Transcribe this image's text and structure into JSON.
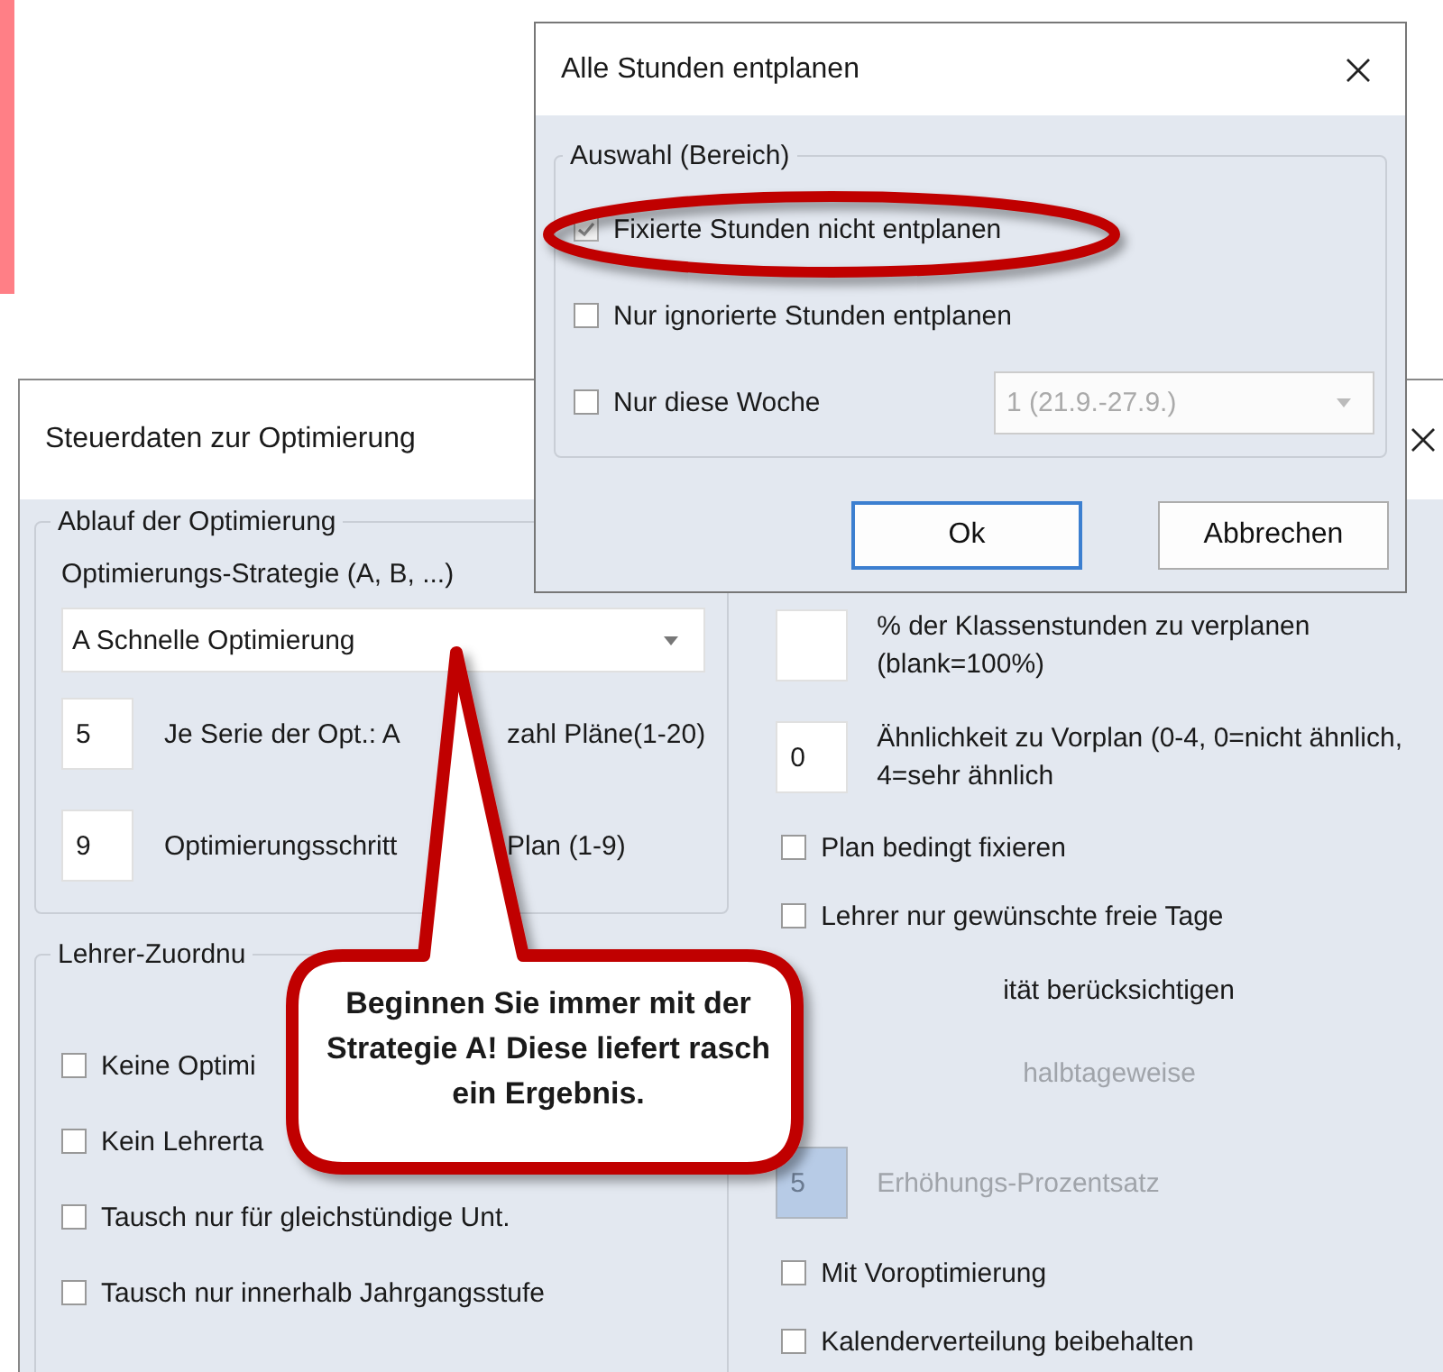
{
  "optimization_window": {
    "title": "Steuerdaten zur Optimierung",
    "sequence_group": {
      "legend": "Ablauf der Optimierung",
      "strategy_label": "Optimierungs-Strategie (A, B, ...)",
      "strategy": "A Schnelle Optimierung",
      "fields": [
        {
          "value": "5",
          "label": [
            "Je Serie der Opt.: A",
            "zahl Pläne(1-20)"
          ]
        },
        {
          "value": "9",
          "label": [
            "Optimierungsschritt",
            "Plan (1-9)"
          ]
        }
      ]
    },
    "teacher_group": {
      "legend": "Lehrer-Zuordnu",
      "options": [
        {
          "label": "Keine Optimi",
          "checked": false
        },
        {
          "label": "Kein Lehrerta",
          "checked": false
        },
        {
          "label": "Tausch nur für gleichstündige Unt.",
          "checked": false
        },
        {
          "label": "Tausch nur innerhalb Jahrgangsstufe",
          "checked": false
        }
      ]
    },
    "right_options": [
      {
        "kind": "field",
        "label": "% der Klassenstunden zu verplanen (blank=100%)",
        "disabled": false
      },
      {
        "kind": "field",
        "value": "0",
        "label": "Ähnlichkeit zu Vorplan (0-4, 0=nicht ähnlich, 4=sehr ähnlich",
        "disabled": false
      },
      {
        "kind": "checkbox",
        "label": "Plan bedingt fixieren",
        "checked": false,
        "disabled": false
      },
      {
        "kind": "checkbox",
        "label": "Lehrer nur gewünschte freie Tage",
        "checked": false,
        "disabled": false
      },
      {
        "kind": "fragment",
        "label": "ität berücksichtigen",
        "disabled": false
      },
      {
        "kind": "fragment",
        "label": "halbtageweise",
        "disabled": true
      },
      {
        "kind": "field",
        "value": "5",
        "label": "Erhöhungs-Prozentsatz",
        "disabled": true
      },
      {
        "kind": "checkbox",
        "label": "Mit Voroptimierung",
        "checked": false,
        "disabled": false
      },
      {
        "kind": "checkbox",
        "label": "Kalenderverteilung beibehalten",
        "checked": false,
        "disabled": false
      }
    ]
  },
  "dialog": {
    "title": "Alle Stunden entplanen",
    "legend": "Auswahl (Bereich)",
    "options": [
      {
        "label": "Fixierte Stunden nicht entplanen",
        "checked": true,
        "disabled": true,
        "highlighted": true
      },
      {
        "label": "Nur ignorierte Stunden entplanen",
        "checked": false,
        "disabled": false,
        "highlighted": false
      },
      {
        "label": "Nur diese Woche",
        "checked": false,
        "disabled": false,
        "highlighted": false,
        "week": "1 (21.9.-27.9.)"
      }
    ],
    "buttons": [
      {
        "label": "Ok",
        "default": true
      },
      {
        "label": "Abbrechen",
        "default": false
      }
    ]
  },
  "callout": {
    "text": "Beginnen Sie immer mit der Strategie A! Diese liefert rasch ein Ergebnis."
  }
}
